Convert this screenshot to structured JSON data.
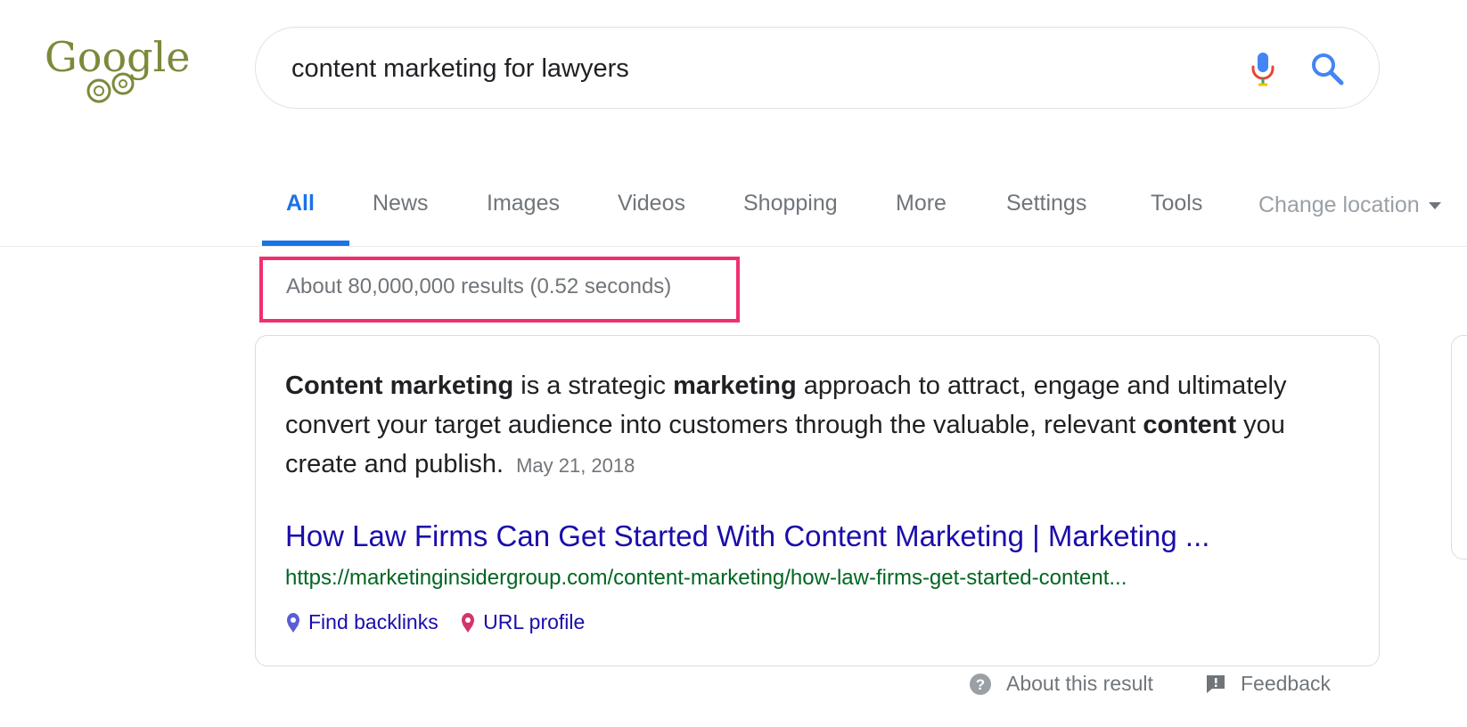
{
  "logo": {
    "text": "Google"
  },
  "search": {
    "query": "content marketing for lawyers",
    "mic_icon": "microphone-icon",
    "search_icon": "magnifier-icon"
  },
  "tabs": [
    {
      "label": "All",
      "active": true
    },
    {
      "label": "News"
    },
    {
      "label": "Images"
    },
    {
      "label": "Videos"
    },
    {
      "label": "Shopping"
    },
    {
      "label": "More"
    },
    {
      "label": "Settings"
    },
    {
      "label": "Tools"
    }
  ],
  "change_location": "Change location",
  "result_stats": "About 80,000,000 results (0.52 seconds)",
  "featured_snippet": {
    "segments": [
      {
        "text": "Content marketing",
        "bold": true
      },
      {
        "text": " is a strategic ",
        "bold": false
      },
      {
        "text": "marketing",
        "bold": true
      },
      {
        "text": " approach to attract, engage and ultimately convert your target audience into customers through the valuable, relevant ",
        "bold": false
      },
      {
        "text": "content",
        "bold": true
      },
      {
        "text": " you create and publish.",
        "bold": false
      }
    ],
    "date": "May 21, 2018",
    "title": "How Law Firms Can Get Started With Content Marketing | Marketing ...",
    "url": "https://marketinginsidergroup.com/content-marketing/how-law-firms-get-started-content...",
    "tools": [
      {
        "label": "Find backlinks",
        "icon": "backlinks-icon",
        "color": "#5a5ed6"
      },
      {
        "label": "URL profile",
        "icon": "url-profile-icon",
        "color": "#d6336c"
      }
    ]
  },
  "footer": {
    "about": "About this result",
    "feedback": "Feedback"
  },
  "colors": {
    "accent_blue": "#1a73e8",
    "link": "#1a0dab",
    "url_green": "#006621",
    "highlight_pink": "#f0306e",
    "logo_olive": "#7b8a3a"
  }
}
